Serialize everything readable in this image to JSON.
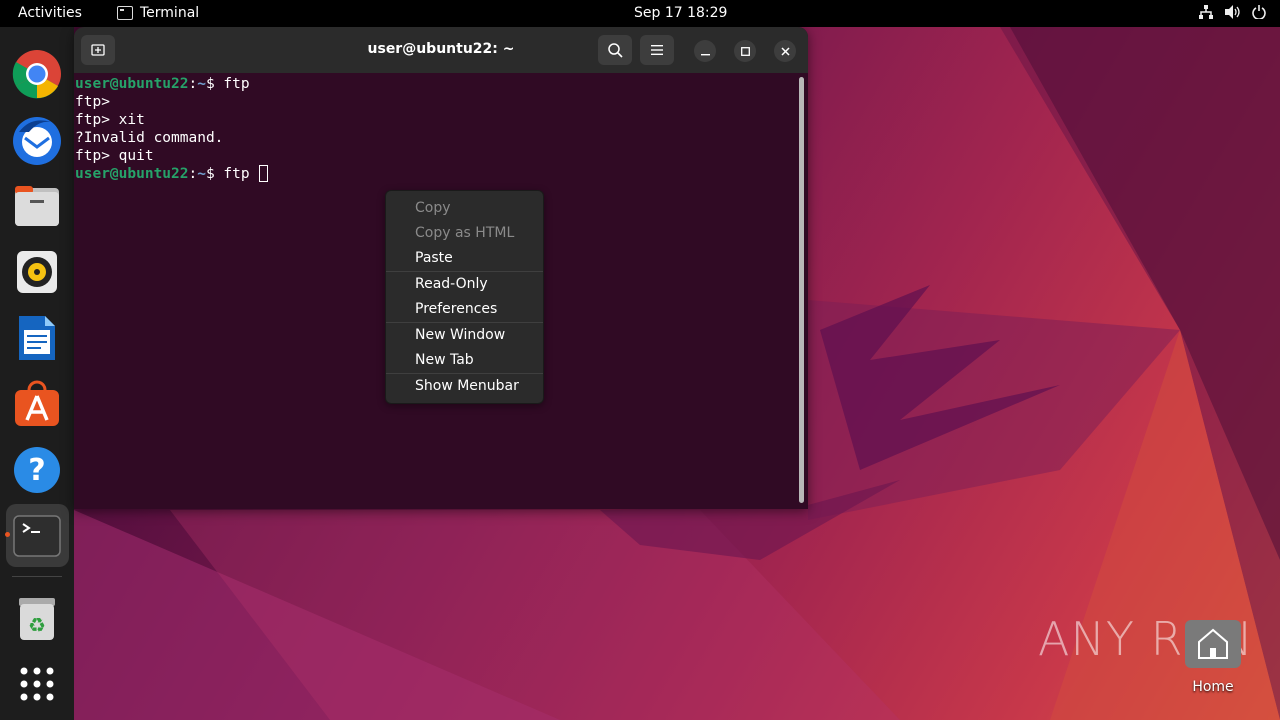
{
  "topbar": {
    "activities": "Activities",
    "app_name": "Terminal",
    "clock": "Sep 17  18:29",
    "tray_icons": [
      "network-icon",
      "volume-icon",
      "power-icon"
    ]
  },
  "dock": {
    "items": [
      {
        "name": "chrome",
        "icon": "chrome-icon"
      },
      {
        "name": "thunderbird",
        "icon": "thunderbird-icon"
      },
      {
        "name": "files",
        "icon": "files-icon"
      },
      {
        "name": "rhythmbox",
        "icon": "rhythmbox-icon"
      },
      {
        "name": "libreoffice-writer",
        "icon": "writer-icon"
      },
      {
        "name": "app-center",
        "icon": "app-center-icon"
      },
      {
        "name": "help",
        "icon": "help-icon"
      },
      {
        "name": "terminal",
        "icon": "terminal-icon",
        "active": true
      },
      {
        "name": "trash",
        "icon": "trash-icon"
      },
      {
        "name": "show-apps",
        "icon": "grid-icon"
      }
    ]
  },
  "window": {
    "title": "user@ubuntu22: ~",
    "lines": [
      {
        "user": "user@ubuntu22",
        "sep": ":",
        "path": "~",
        "cmd": "$ ftp"
      },
      {
        "text": "ftp>"
      },
      {
        "text": "ftp> xit"
      },
      {
        "text": "?Invalid command."
      },
      {
        "text": "ftp> quit"
      },
      {
        "user": "user@ubuntu22",
        "sep": ":",
        "path": "~",
        "cmd": "$ ftp "
      }
    ]
  },
  "context_menu": {
    "items": [
      {
        "label": "Copy",
        "enabled": false
      },
      {
        "label": "Copy as HTML",
        "enabled": false
      },
      {
        "label": "Paste",
        "enabled": true
      },
      {
        "label": "Read-Only",
        "enabled": true
      },
      {
        "label": "Preferences",
        "enabled": true
      },
      {
        "label": "New Window",
        "enabled": true
      },
      {
        "label": "New Tab",
        "enabled": true
      },
      {
        "label": "Show Menubar",
        "enabled": true
      }
    ]
  },
  "desktop": {
    "home_label": "Home",
    "watermark": "ANY RUN"
  },
  "colors": {
    "terminal_bg": "#300a24",
    "prompt_user": "#26a269",
    "prompt_path": "#729fcf",
    "accent": "#e95420"
  }
}
